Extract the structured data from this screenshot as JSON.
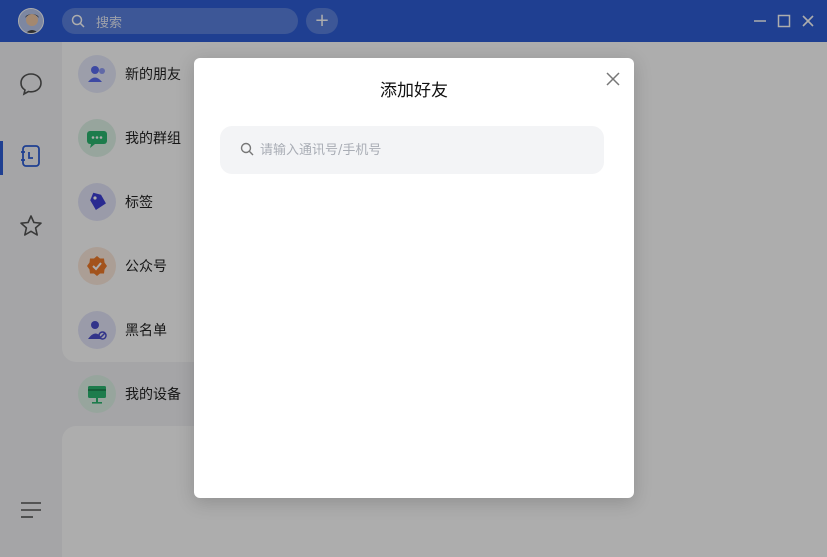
{
  "titlebar": {
    "search_placeholder": "搜索",
    "add_label": "+",
    "bg_color": "#2e5ed6"
  },
  "rail": {
    "items": [
      {
        "icon": "chat-bubble-icon",
        "active": false
      },
      {
        "icon": "contacts-book-icon",
        "active": true
      },
      {
        "icon": "star-icon",
        "active": false
      }
    ],
    "bottom_icon": "menu-icon"
  },
  "contacts": {
    "items": [
      {
        "label": "新的朋友",
        "icon": "new-friend-icon",
        "color": "#5b6cf0"
      },
      {
        "label": "我的群组",
        "icon": "group-chat-icon",
        "color": "#2cb771"
      },
      {
        "label": "标签",
        "icon": "tag-icon",
        "color": "#3d3fd6"
      },
      {
        "label": "公众号",
        "icon": "official-account-icon",
        "color": "#f07b2a"
      },
      {
        "label": "黑名单",
        "icon": "blacklist-icon",
        "color": "#4a4dcc"
      },
      {
        "label": "我的设备",
        "icon": "device-icon",
        "color": "#2cb771"
      }
    ]
  },
  "modal": {
    "title": "添加好友",
    "search_placeholder": "请输入通讯号/手机号",
    "search_value": ""
  }
}
